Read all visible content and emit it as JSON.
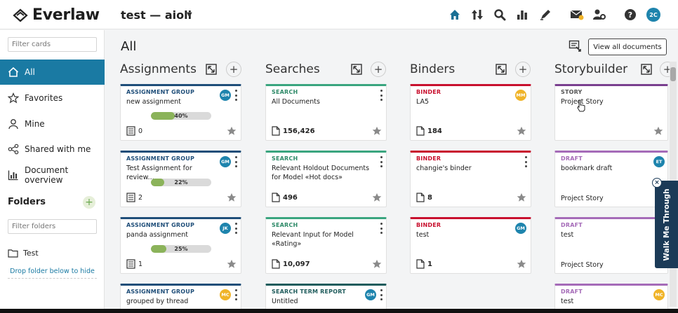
{
  "header": {
    "logo_text": "Everlaw",
    "case_title": "test — aioli",
    "avatar": "2C",
    "icons": [
      "home-icon",
      "sort-icon",
      "search-icon",
      "analytics-icon",
      "pen-icon",
      "messages-icon",
      "admin-icon",
      "help-icon"
    ]
  },
  "sidebar": {
    "filter_cards_placeholder": "Filter cards",
    "items": [
      {
        "label": "All",
        "icon": "home-icon"
      },
      {
        "label": "Favorites",
        "icon": "star-icon"
      },
      {
        "label": "Mine",
        "icon": "person-icon"
      },
      {
        "label": "Shared with me",
        "icon": "share-icon"
      },
      {
        "label": "Document overview",
        "icon": "chart-icon"
      }
    ],
    "folders_label": "Folders",
    "filter_folders_placeholder": "Filter folders",
    "folder": "Test",
    "drop_note": "Drop folder below to hide"
  },
  "main": {
    "title": "All",
    "view_all_label": "View all documents",
    "columns": [
      "Assignments",
      "Searches",
      "Binders",
      "Storybuilder"
    ]
  },
  "colors": {
    "assignment": "#1f4e79",
    "search": "#3aa57f",
    "binder": "#c8102e",
    "story": "#7a3f8f",
    "draft": "#a56bb8",
    "search_term": "#1f5c5c",
    "accent": "#1a7aa3"
  },
  "cards": {
    "a1": {
      "type": "ASSIGNMENT GROUP",
      "name": "new assignment",
      "avatar": "GM",
      "progress": 40,
      "progress_text": "40%",
      "count": "0"
    },
    "a2": {
      "type": "ASSIGNMENT GROUP",
      "name": "Test Assignment for review...",
      "avatar": "GM",
      "progress": 22,
      "progress_text": "22%",
      "count": "2"
    },
    "a3": {
      "type": "ASSIGNMENT GROUP",
      "name": "panda assignment",
      "avatar": "JK",
      "progress": 25,
      "progress_text": "25%",
      "count": "1"
    },
    "a4": {
      "type": "ASSIGNMENT GROUP",
      "name": "grouped by thread",
      "avatar": "MC"
    },
    "s1": {
      "type": "SEARCH",
      "name": "All Documents",
      "count": "156,426"
    },
    "s2": {
      "type": "SEARCH",
      "name": "Relevant Holdout Documents for Model «Hot docs»",
      "count": "496"
    },
    "s3": {
      "type": "SEARCH",
      "name": "Relevant Input for Model «Rating»",
      "count": "10,097"
    },
    "s4": {
      "type": "SEARCH TERM REPORT",
      "name": "Untitled",
      "avatar": "GM"
    },
    "b1": {
      "type": "BINDER",
      "name": "LA5",
      "avatar": "MM",
      "count": "184"
    },
    "b2": {
      "type": "BINDER",
      "name": "changie's binder",
      "count": "8"
    },
    "b3": {
      "type": "BINDER",
      "name": "test",
      "avatar": "GM",
      "count": "1"
    },
    "st1": {
      "type": "STORY",
      "name": "Project Story"
    },
    "st2": {
      "type": "DRAFT",
      "name": "bookmark draft",
      "avatar": "ET",
      "footer": "Project Story"
    },
    "st3": {
      "type": "DRAFT",
      "name": "test",
      "footer": "Project Story"
    },
    "st4": {
      "type": "DRAFT",
      "name": "test",
      "avatar": "MC"
    }
  },
  "walkme": {
    "label": "Walk Me Through",
    "close": "×"
  }
}
